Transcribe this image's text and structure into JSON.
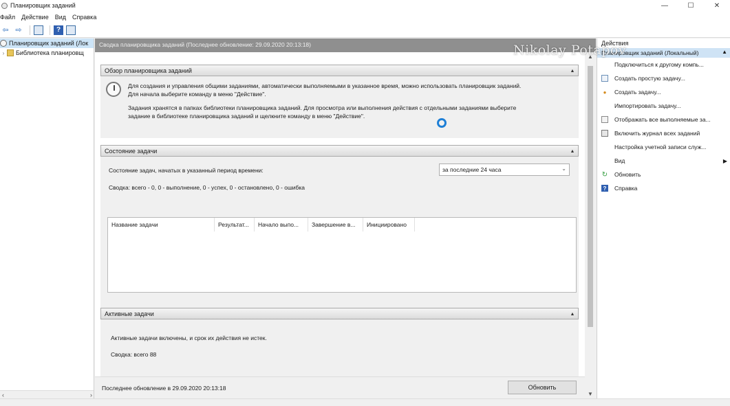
{
  "window": {
    "title": "Планировщик заданий",
    "minimize": "—",
    "maximize": "☐",
    "close": "✕"
  },
  "menu": [
    "Файл",
    "Действие",
    "Вид",
    "Справка"
  ],
  "tree": {
    "items": [
      {
        "label": "Планировщик заданий (Лок",
        "icon": "clock-icon"
      },
      {
        "label": "Библиотека планировщ",
        "icon": "folder-icon"
      }
    ]
  },
  "center": {
    "header": "Сводка планировщика заданий (Последнее обновление: 29.09.2020 20:13:18)",
    "overview": {
      "title": "Обзор планировщика заданий",
      "p1": "Для создания и управления общими заданиями, автоматически выполняемыми в указанное время, можно использовать планировщик заданий.",
      "p1b": "Для начала выберите команду в меню \"Действие\".",
      "p2": "Задания хранятся в папках библиотеки планировщика заданий. Для просмотра или выполнения действия с отдельными заданиями выберите",
      "p2b": "задание в библиотеке планировщика заданий и щелкните команду в меню \"Действие\"."
    },
    "status": {
      "title": "Состояние задачи",
      "period_label": "Состояние задач, начатых в указанный период времени:",
      "period_value": "за последние 24 часа",
      "summary": "Сводка: всего - 0, 0 - выполнение, 0 - успех, 0 - остановлено, 0 - ошибка",
      "columns": [
        "Название задачи",
        "Результат...",
        "Начало выпо...",
        "Завершение в...",
        "Инициировано"
      ]
    },
    "active": {
      "title": "Активные задачи",
      "text": "Активные задачи включены, и срок их действия не истек.",
      "summary": "Сводка: всего 88"
    },
    "footer": {
      "last_update": "Последнее обновление в 29.09.2020 20:13:18",
      "refresh": "Обновить"
    }
  },
  "actions": {
    "title": "Действия",
    "group": "Планировщик заданий (Локальный)",
    "items": [
      {
        "label": "Подключиться к другому компь...",
        "icon": ""
      },
      {
        "label": "Создать простую задачу...",
        "icon": "wizard-icon"
      },
      {
        "label": "Создать задачу...",
        "icon": "new-task-icon"
      },
      {
        "label": "Импортировать задачу...",
        "icon": ""
      },
      {
        "label": "Отображать все выполняемые за...",
        "icon": "running-tasks-icon"
      },
      {
        "label": "Включить журнал всех заданий",
        "icon": "log-icon"
      },
      {
        "label": "Настройка учетной записи служ...",
        "icon": ""
      },
      {
        "label": "Вид",
        "icon": ""
      },
      {
        "label": "Обновить",
        "icon": "refresh-icon"
      },
      {
        "label": "Справка",
        "icon": "help-icon"
      }
    ]
  },
  "watermark": "Nikolay Potapov"
}
